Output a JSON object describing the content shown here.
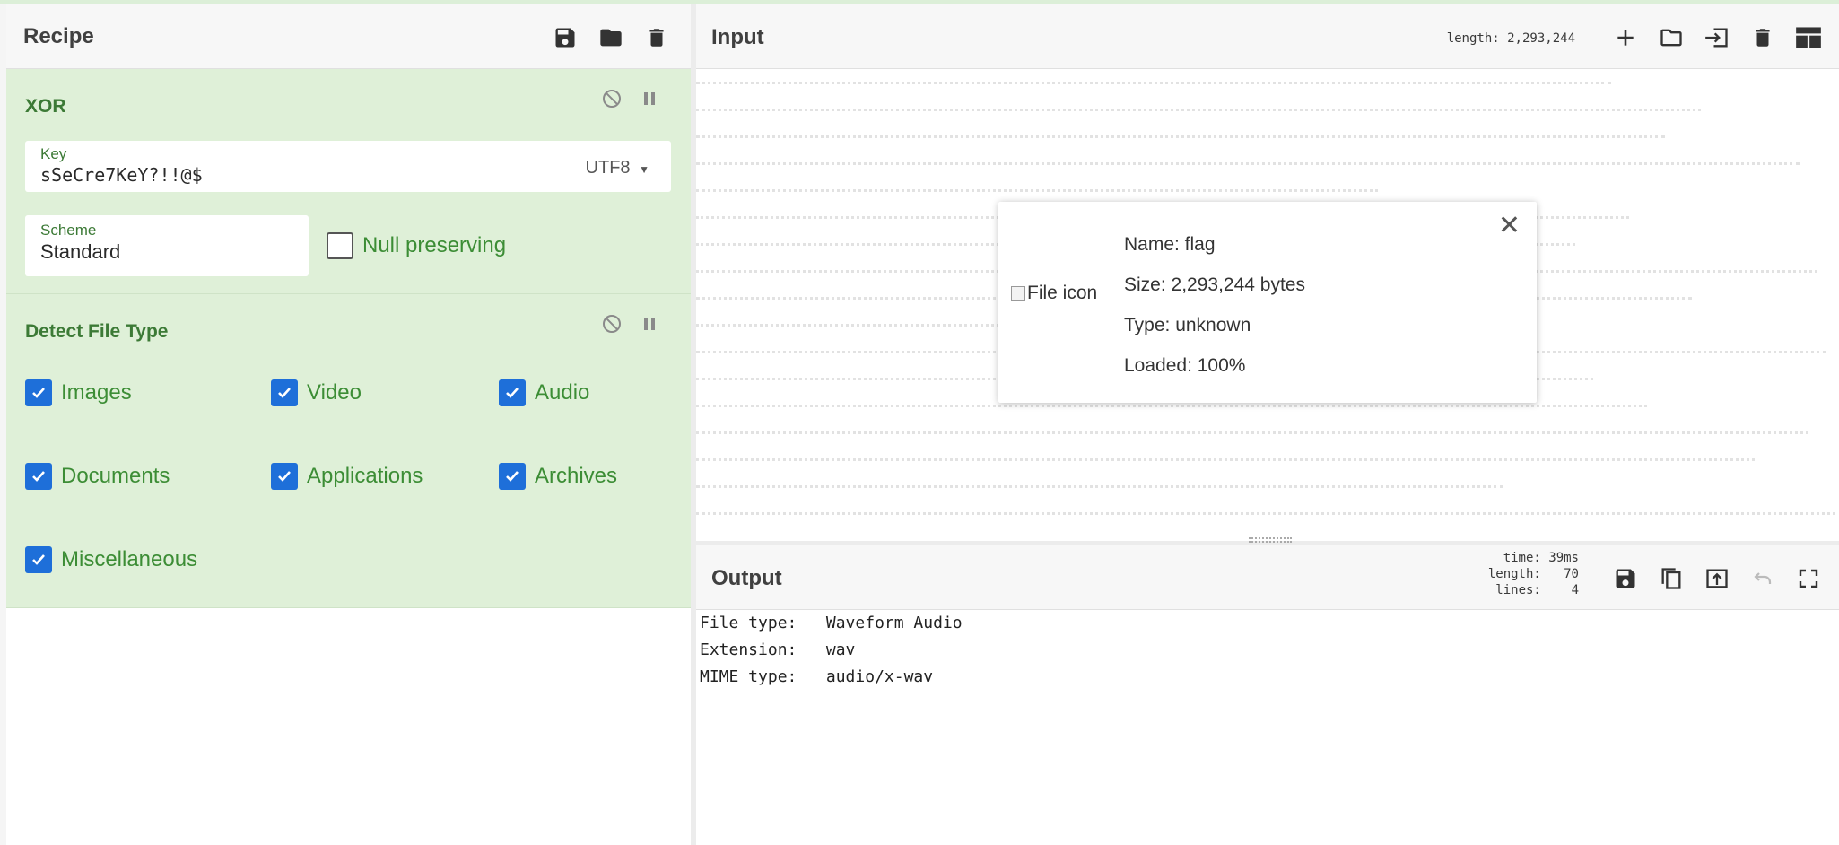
{
  "recipe": {
    "title": "Recipe",
    "icons": [
      "save-icon",
      "folder-icon",
      "trash-icon"
    ],
    "operations": [
      {
        "name": "XOR",
        "key": {
          "label": "Key",
          "value": "sSeCre7KeY?!!@$",
          "encoding": "UTF8"
        },
        "scheme": {
          "label": "Scheme",
          "value": "Standard"
        },
        "null_preserving": {
          "label": "Null preserving",
          "checked": false
        }
      },
      {
        "name": "Detect File Type",
        "options": [
          {
            "label": "Images",
            "checked": true
          },
          {
            "label": "Video",
            "checked": true
          },
          {
            "label": "Audio",
            "checked": true
          },
          {
            "label": "Documents",
            "checked": true
          },
          {
            "label": "Applications",
            "checked": true
          },
          {
            "label": "Archives",
            "checked": true
          },
          {
            "label": "Miscellaneous",
            "checked": true
          }
        ]
      }
    ]
  },
  "input": {
    "title": "Input",
    "length": "length: 2,293,244",
    "icons": [
      "plus-icon",
      "folder-icon",
      "import-icon",
      "trash-icon",
      "layout-icon"
    ],
    "file": {
      "image_alt": "File icon",
      "name": "Name: flag",
      "size": "Size: 2,293,244 bytes",
      "type": "Type: unknown",
      "loaded": "Loaded: 100%"
    }
  },
  "output": {
    "title": "Output",
    "stats": {
      "time": "time: 39ms",
      "length": "length:   70",
      "lines": "lines:    4"
    },
    "icons": [
      "save-icon",
      "copy-icon",
      "open-in-input-icon",
      "undo-icon",
      "maximize-icon"
    ],
    "lines": [
      "File type:   Waveform Audio",
      "Extension:   wav",
      "MIME type:   audio/x-wav"
    ]
  },
  "colors": {
    "operation_bg": "#dff0d8",
    "operation_text": "#3c7a36",
    "checkbox": "#1e6fd9"
  }
}
